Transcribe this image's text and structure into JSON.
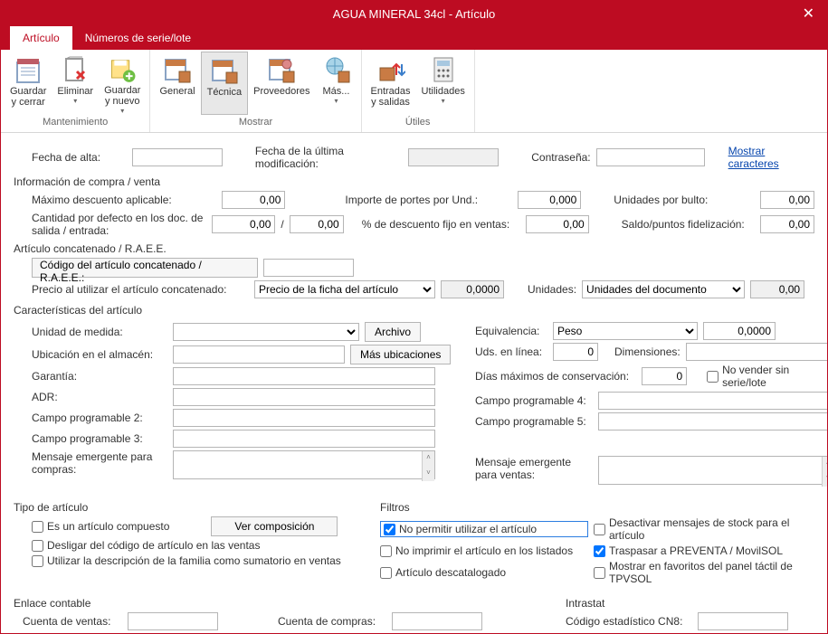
{
  "window": {
    "title": "AGUA MINERAL 34cl - Artículo"
  },
  "tabs": {
    "articulo": "Artículo",
    "series": "Números de serie/lote"
  },
  "ribbon": {
    "mantenimiento": {
      "label": "Mantenimiento",
      "guardar_cerrar": "Guardar\ny cerrar",
      "eliminar": "Eliminar",
      "guardar_nuevo": "Guardar\ny nuevo"
    },
    "mostrar": {
      "label": "Mostrar",
      "general": "General",
      "tecnica": "Técnica",
      "proveedores": "Proveedores",
      "mas": "Más..."
    },
    "utiles": {
      "label": "Útiles",
      "entradas": "Entradas\ny salidas",
      "utilidades": "Utilidades"
    }
  },
  "fields": {
    "fecha_alta": "Fecha de alta:",
    "fecha_mod": "Fecha de la última modificación:",
    "contrasena": "Contraseña:",
    "mostrar_car": "Mostrar caracteres",
    "info_compra": "Información de compra / venta",
    "max_desc": "Máximo descuento aplicable:",
    "max_desc_v": "0,00",
    "cant_def": "Cantidad por defecto en los doc. de salida / entrada:",
    "cant_def_v1": "0,00",
    "cant_def_sep": "/",
    "cant_def_v2": "0,00",
    "importe_portes": "Importe de portes por Und.:",
    "importe_portes_v": "0,000",
    "pct_desc": "% de descuento fijo en ventas:",
    "pct_desc_v": "0,00",
    "uds_bulto": "Unidades por bulto:",
    "uds_bulto_v": "0,00",
    "saldo_fid": "Saldo/puntos fidelización:",
    "saldo_fid_v": "0,00",
    "concat_h": "Artículo concatenado / R.A.E.E.",
    "concat_code": "Código del artículo concatenado / R.A.E.E.:",
    "precio_concat": "Precio al utilizar el artículo concatenado:",
    "precio_concat_opt": "Precio de la ficha del artículo",
    "precio_concat_v": "0,0000",
    "unidades_lbl": "Unidades:",
    "unidades_opt": "Unidades del documento",
    "unidades_v": "0,00",
    "caract_h": "Características del artículo",
    "ud_medida": "Unidad de medida:",
    "archivo": "Archivo",
    "equivalencia": "Equivalencia:",
    "equivalencia_opt": "Peso",
    "equivalencia_v": "0,0000",
    "ubicacion": "Ubicación en el almacén:",
    "mas_ubic": "Más ubicaciones",
    "uds_linea": "Uds. en línea:",
    "uds_linea_v": "0",
    "dimensiones": "Dimensiones:",
    "garantia": "Garantía:",
    "dias_conserv": "Días máximos de conservación:",
    "dias_conserv_v": "0",
    "no_vender_sin": "No vender sin serie/lote",
    "adr": "ADR:",
    "campo4": "Campo programable 4:",
    "campo2": "Campo programable 2:",
    "campo5": "Campo programable 5:",
    "campo3": "Campo programable 3:",
    "msg_compras": "Mensaje emergente para compras:",
    "msg_ventas": "Mensaje emergente para ventas:",
    "tipo_h": "Tipo de artículo",
    "filtros_h": "Filtros",
    "es_compuesto": "Es un artículo compuesto",
    "ver_comp": "Ver composición",
    "desligar": "Desligar del código de artículo en las ventas",
    "util_desc_fam": "Utilizar la descripción de la familia como sumatorio en ventas",
    "no_permitir": "No permitir utilizar el artículo",
    "no_imprimir": "No imprimir el artículo en los listados",
    "descatalogado": "Artículo descatalogado",
    "desact_stock": "Desactivar mensajes de stock para el artículo",
    "traspasar": "Traspasar a PREVENTA / MovilSOL",
    "favoritos": "Mostrar en favoritos del panel táctil de TPVSOL",
    "enlace_h": "Enlace contable",
    "intrastat_h": "Intrastat",
    "cta_ventas": "Cuenta de ventas:",
    "cta_compras": "Cuenta de compras:",
    "cn8": "Código estadístico CN8:"
  }
}
